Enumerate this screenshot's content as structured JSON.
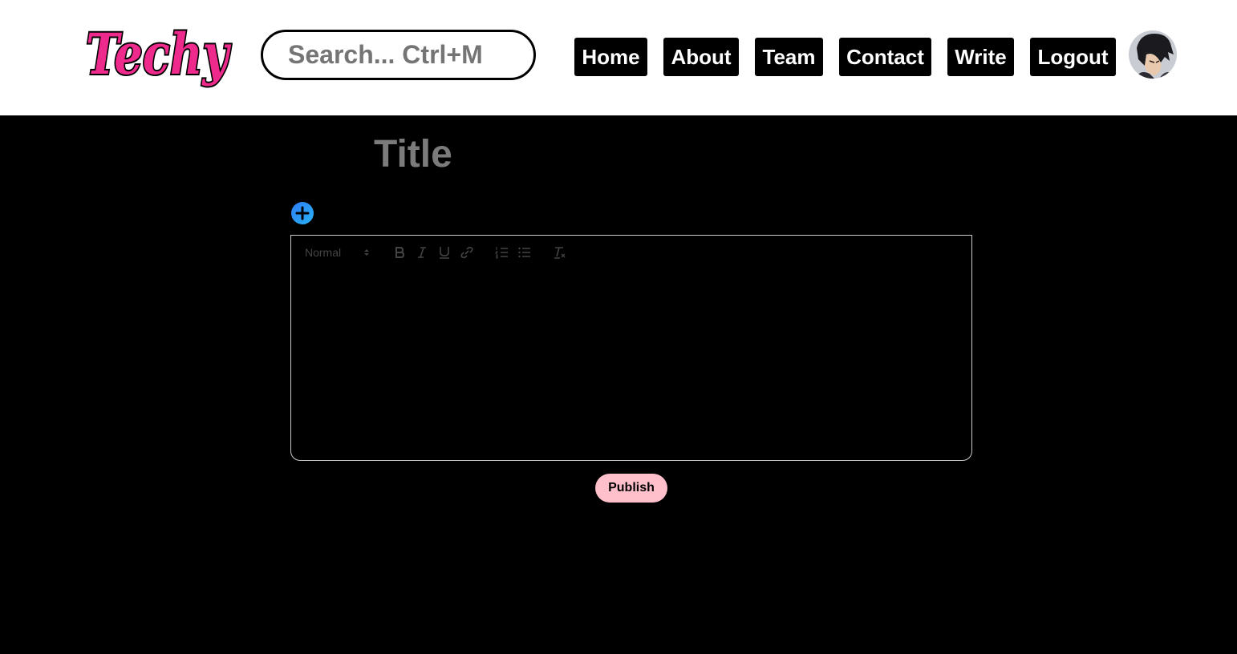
{
  "header": {
    "logo_text": "Techy",
    "search": {
      "placeholder": "Search... Ctrl+M",
      "value": ""
    },
    "nav": [
      {
        "label": "Home"
      },
      {
        "label": "About"
      },
      {
        "label": "Team"
      },
      {
        "label": "Contact"
      },
      {
        "label": "Write"
      },
      {
        "label": "Logout"
      }
    ],
    "avatar_icon": "user-avatar-photo"
  },
  "editor": {
    "title": {
      "placeholder": "Title",
      "value": ""
    },
    "add_icon": "plus-circle-icon",
    "toolbar": {
      "header_picker": "Normal",
      "buttons": [
        "bold-icon",
        "italic-icon",
        "underline-icon",
        "link-icon",
        "ordered-list-icon",
        "bullet-list-icon",
        "clear-format-icon"
      ]
    },
    "body": ""
  },
  "actions": {
    "publish_label": "Publish"
  },
  "colors": {
    "background": "#000000",
    "header_bg": "#ffffff",
    "logo_pink": "#ee2a8c",
    "publish_bg": "#ffc0cb",
    "add_gradient_start": "#2f7df6",
    "add_gradient_end": "#28b2f3",
    "editor_border": "#cccccc"
  }
}
